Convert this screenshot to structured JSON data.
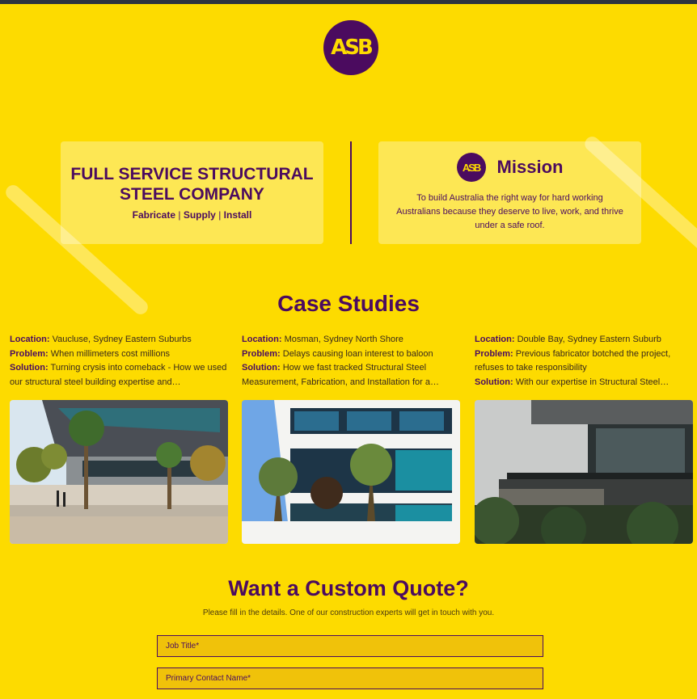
{
  "brand": {
    "logo_text": "ASB"
  },
  "left_card": {
    "title": "FULL SERVICE STRUCTURAL\nSTEEL COMPANY",
    "links": [
      "Fabricate",
      "Supply",
      "Install"
    ],
    "separator": "|"
  },
  "mission": {
    "logo_text": "ASB",
    "title": "Mission",
    "text": "To build Australia the right way for hard working Australians because they deserve to live, work, and thrive under a safe roof."
  },
  "case_studies": {
    "title": "Case Studies",
    "labels": {
      "location": "Location:",
      "problem": "Problem:",
      "solution": "Solution:"
    },
    "items": [
      {
        "location": "Vaucluse, Sydney Eastern Suburbs",
        "problem": "When millimeters cost millions",
        "solution": "Turning crysis into comeback - How we used our structural steel building expertise and…"
      },
      {
        "location": "Mosman, Sydney North Shore",
        "problem": "Delays causing loan interest to baloon",
        "solution": "How we fast tracked Structural Steel Measurement, Fabrication, and Installation for a…"
      },
      {
        "location": "Double Bay, Sydney Eastern Suburb",
        "problem": "Previous fabricator botched the project, refuses to take responsibility",
        "solution": "With our expertise in Structural Steel…"
      }
    ]
  },
  "quote": {
    "title": "Want a Custom Quote?",
    "subtitle": "Please fill in the details. One of our construction experts will get in touch with you.",
    "fields": {
      "job_title_placeholder": "Job Title*",
      "contact_name_placeholder": "Primary Contact Name*"
    }
  },
  "colors": {
    "background": "#fddb00",
    "accent": "#4b0b5f"
  }
}
